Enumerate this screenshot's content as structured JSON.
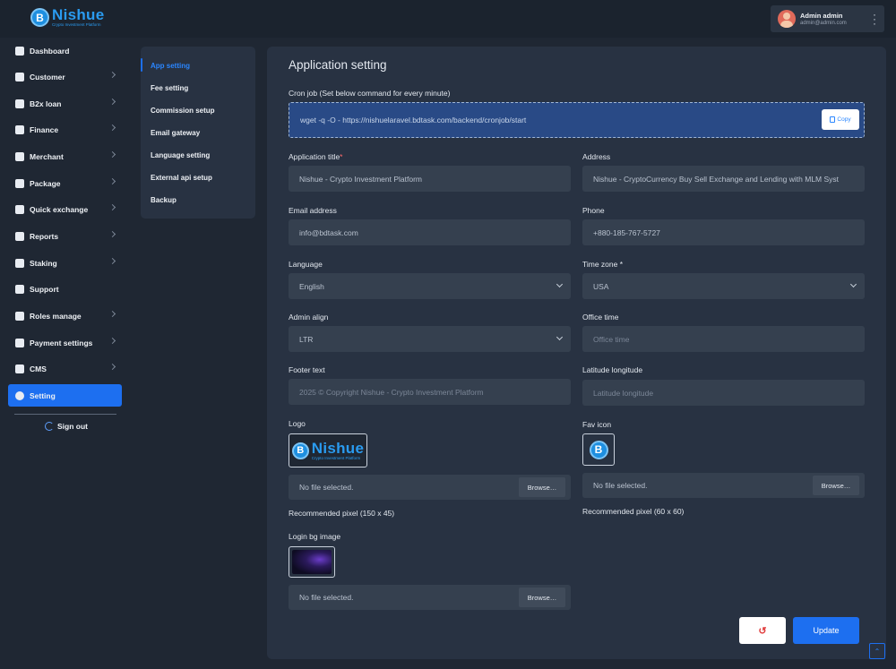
{
  "brand": {
    "name": "Nishue",
    "tagline": "Crypto Investment Platform",
    "coin_glyph": "B"
  },
  "user": {
    "name": "Admin admin",
    "email": "admin@admin.com",
    "menu_icon": "kebab-icon"
  },
  "sidebar": {
    "items": [
      {
        "label": "Dashboard",
        "icon": "dashboard-icon",
        "has_children": false
      },
      {
        "label": "Customer",
        "icon": "customer-icon",
        "has_children": true
      },
      {
        "label": "B2x loan",
        "icon": "loan-icon",
        "has_children": true
      },
      {
        "label": "Finance",
        "icon": "finance-icon",
        "has_children": true
      },
      {
        "label": "Merchant",
        "icon": "merchant-icon",
        "has_children": true
      },
      {
        "label": "Package",
        "icon": "package-icon",
        "has_children": true
      },
      {
        "label": "Quick exchange",
        "icon": "exchange-icon",
        "has_children": true
      },
      {
        "label": "Reports",
        "icon": "reports-icon",
        "has_children": true
      },
      {
        "label": "Staking",
        "icon": "staking-icon",
        "has_children": true
      },
      {
        "label": "Support",
        "icon": "support-icon",
        "has_children": false
      },
      {
        "label": "Roles manage",
        "icon": "roles-icon",
        "has_children": true
      },
      {
        "label": "Payment settings",
        "icon": "payment-icon",
        "has_children": true
      },
      {
        "label": "CMS",
        "icon": "cms-icon",
        "has_children": true
      },
      {
        "label": "Setting",
        "icon": "gear-icon",
        "has_children": false,
        "active": true
      }
    ],
    "signout": "Sign out"
  },
  "submenu": {
    "items": [
      "App setting",
      "Fee setting",
      "Commission setup",
      "Email gateway",
      "Language setting",
      "External api setup",
      "Backup"
    ],
    "active_index": 0
  },
  "form": {
    "title": "Application setting",
    "cron": {
      "label": "Cron job (Set below command for every minute)",
      "command": "wget -q -O - https://nishuelaravel.bdtask.com/backend/cronjob/start",
      "copy_label": "Copy"
    },
    "app_title": {
      "label": "Application title",
      "required": "*",
      "value": "Nishue - Crypto Investment Platform"
    },
    "address": {
      "label": "Address",
      "value": "Nishue - CryptoCurrency Buy Sell Exchange and Lending with MLM Syst"
    },
    "email": {
      "label": "Email address",
      "value": "info@bdtask.com"
    },
    "phone": {
      "label": "Phone",
      "value": "+880-185-767-5727"
    },
    "language": {
      "label": "Language",
      "value": "English"
    },
    "timezone": {
      "label": "Time zone *",
      "value": "USA"
    },
    "admin_align": {
      "label": "Admin align",
      "value": "LTR"
    },
    "office_time": {
      "label": "Office time",
      "placeholder": "Office time"
    },
    "footer_text": {
      "label": "Footer text",
      "placeholder": "2025 © Copyright Nishue - Crypto Investment Platform"
    },
    "latlng": {
      "label": "Latitude longitude",
      "placeholder": "Latitude longitude"
    },
    "logo": {
      "label": "Logo",
      "file_status": "No file selected.",
      "browse": "Browse…",
      "note": "Recommended pixel (150 x 45)"
    },
    "favicon": {
      "label": "Fav icon",
      "file_status": "No file selected.",
      "browse": "Browse…",
      "note": "Recommended pixel (60 x 60)"
    },
    "login_bg": {
      "label": "Login bg image",
      "file_status": "No file selected.",
      "browse": "Browse…"
    },
    "reset_icon": "reset-icon",
    "update_label": "Update"
  },
  "colors": {
    "accent": "#1d6ff0",
    "bg": "#1f2733",
    "panel": "#283242",
    "input": "#35404f"
  }
}
